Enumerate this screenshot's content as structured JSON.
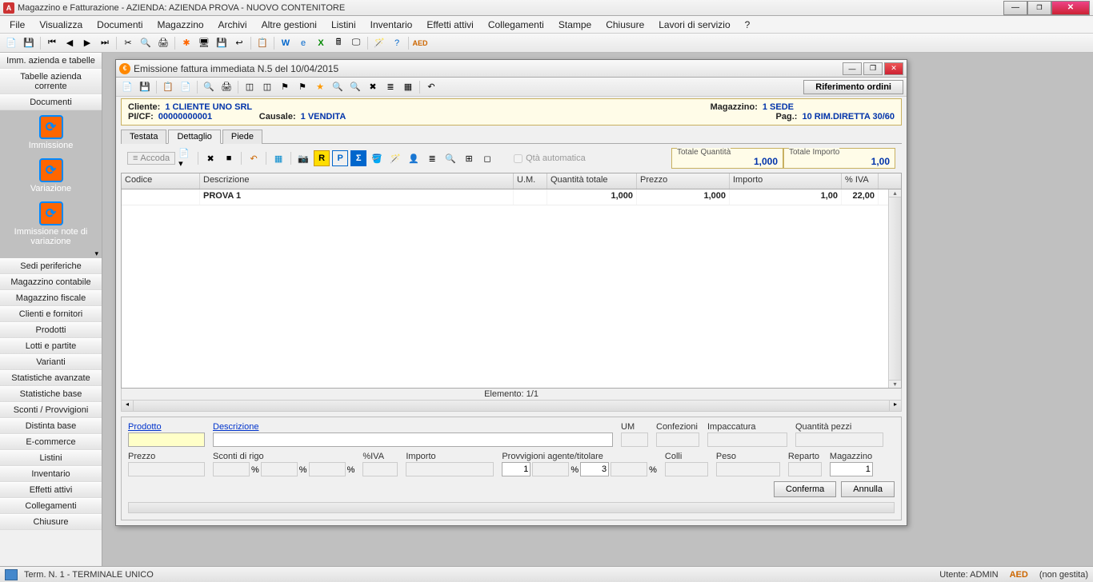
{
  "main_window": {
    "title": "Magazzino e Fatturazione - AZIENDA: AZIENDA PROVA - NUOVO CONTENITORE"
  },
  "menubar": [
    "File",
    "Visualizza",
    "Documenti",
    "Magazzino",
    "Archivi",
    "Altre gestioni",
    "Listini",
    "Inventario",
    "Effetti attivi",
    "Collegamenti",
    "Stampe",
    "Chiusure",
    "Lavori di servizio",
    "?"
  ],
  "sidebar": {
    "top": [
      "Imm. azienda e tabelle",
      "Tabelle azienda corrente",
      "Documenti"
    ],
    "big": [
      {
        "label": "Immissione"
      },
      {
        "label": "Variazione"
      },
      {
        "label": "Immissione note di variazione"
      }
    ],
    "bottom": [
      "Sedi periferiche",
      "Magazzino contabile",
      "Magazzino fiscale",
      "Clienti e fornitori",
      "Prodotti",
      "Lotti e partite",
      "Varianti",
      "Statistiche avanzate",
      "Statistiche base",
      "Sconti / Provvigioni",
      "Distinta base",
      "E-commerce",
      "Listini",
      "Inventario",
      "Effetti attivi",
      "Collegamenti",
      "Chiusure"
    ]
  },
  "inner_window": {
    "title": "Emissione fattura immediata N.5 del 10/04/2015",
    "rif_ordini": "Riferimento ordini"
  },
  "header": {
    "cliente_lbl": "Cliente:",
    "cliente_val": "1 CLIENTE UNO SRL",
    "picf_lbl": "PI/CF:",
    "picf_val": "00000000001",
    "causale_lbl": "Causale:",
    "causale_val": "1 VENDITA",
    "magazzino_lbl": "Magazzino:",
    "magazzino_val": "1 SEDE",
    "pag_lbl": "Pag.:",
    "pag_val": "10 RIM.DIRETTA 30/60"
  },
  "tabs": {
    "t1": "Testata",
    "t2": "Dettaglio",
    "t3": "Piede"
  },
  "detail_toolbar": {
    "accoda": "Accoda",
    "qta_auto": "Qtà automatica",
    "tot_q_lbl": "Totale Quantità",
    "tot_q_val": "1,000",
    "tot_i_lbl": "Totale Importo",
    "tot_i_val": "1,00"
  },
  "grid": {
    "cols": {
      "codice": "Codice",
      "descr": "Descrizione",
      "um": "U.M.",
      "qta": "Quantità totale",
      "prezzo": "Prezzo",
      "importo": "Importo",
      "iva": "% IVA"
    },
    "rows": [
      {
        "codice": "",
        "descr": "PROVA 1",
        "um": "",
        "qta": "1,000",
        "prezzo": "1,000",
        "importo": "1,00",
        "iva": "22,00"
      }
    ],
    "elemento": "Elemento: 1/1"
  },
  "form": {
    "prodotto": "Prodotto",
    "descrizione": "Descrizione",
    "um": "UM",
    "confezioni": "Confezioni",
    "impaccatura": "Impaccatura",
    "qpezzi": "Quantità pezzi",
    "prezzo": "Prezzo",
    "sconti": "Sconti di rigo",
    "piva": "%IVA",
    "importo": "Importo",
    "provv": "Provvigioni agente/titolare",
    "colli": "Colli",
    "peso": "Peso",
    "reparto": "Reparto",
    "magazzino": "Magazzino",
    "provv1": "1",
    "provv2": "3",
    "mag_val": "1",
    "conferma": "Conferma",
    "annulla": "Annulla"
  },
  "statusbar": {
    "term": "Term. N. 1 - TERMINALE UNICO",
    "utente": "Utente: ADMIN",
    "gest": "(non gestita)"
  }
}
